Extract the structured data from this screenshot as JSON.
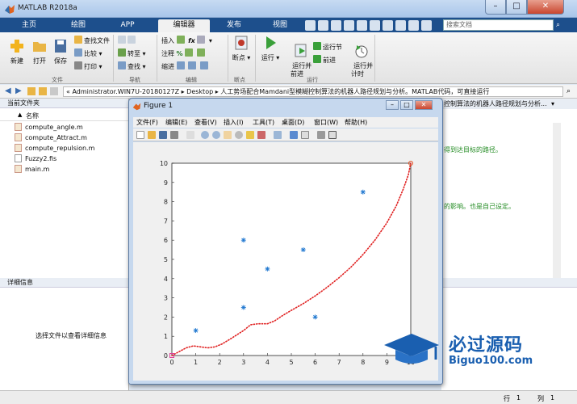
{
  "app": {
    "title": "MATLAB R2018a",
    "window_controls": {
      "min": "–",
      "max": "□",
      "close": "✕"
    }
  },
  "tabs": [
    "主页",
    "绘图",
    "APP",
    "编辑器",
    "发布",
    "视图"
  ],
  "active_tab": "编辑器",
  "search": {
    "placeholder": "搜索文档"
  },
  "ribbon": {
    "file": {
      "new": "新建",
      "open": "打开",
      "save": "保存",
      "find_file": "查找文件",
      "compare": "比较",
      "print": "打印",
      "section": "文件"
    },
    "nav": {
      "goto": "转至",
      "find": "查找",
      "section": "导航"
    },
    "edit": {
      "insert": "插入",
      "comment": "注释",
      "indent": "缩进",
      "section": "编辑"
    },
    "breakpoint": {
      "label": "断点",
      "section": "断点"
    },
    "run": {
      "run": "运行",
      "run_advance": "运行并\n前进",
      "run_section": "运行节",
      "advance": "前进",
      "run_time": "运行并\n计时",
      "section": "运行"
    }
  },
  "address": {
    "path": "« Administrator.WIN7U-20180127Z ▸ Desktop ▸ 人工势场配合Mamdani型模糊控制算法的机器人路径规划与分析。MATLAB代码，可直接运行"
  },
  "left_pane": {
    "title": "当前文件夹",
    "column": "名称",
    "files": [
      "compute_angle.m",
      "compute_Attract.m",
      "compute_repulsion.m",
      "Fuzzy2.fis",
      "main.m"
    ],
    "details_title": "详细信息",
    "details_hint": "选择文件以查看详细信息"
  },
  "editor": {
    "tab": "控制算法的机器人路径规划与分析...",
    "lines": [
      "得到达目标的路径。",
      "的影响。也是自己设定。"
    ]
  },
  "status": {
    "row_label": "行",
    "row": "1",
    "col_label": "列",
    "col": "1"
  },
  "figure": {
    "title": "Figure 1",
    "menu": [
      "文件(F)",
      "编辑(E)",
      "查看(V)",
      "插入(I)",
      "工具(T)",
      "桌面(D)",
      "窗口(W)",
      "帮助(H)"
    ]
  },
  "watermark": {
    "title": "必过源码",
    "url": "Biguo100.com"
  },
  "chart_data": {
    "type": "scatter",
    "xlim": [
      0,
      10
    ],
    "ylim": [
      0,
      10
    ],
    "xticks": [
      0,
      1,
      2,
      3,
      4,
      5,
      6,
      7,
      8,
      9,
      10
    ],
    "yticks": [
      0,
      1,
      2,
      3,
      4,
      5,
      6,
      7,
      8,
      9,
      10
    ],
    "grid": false,
    "obstacles": {
      "marker": "*",
      "color": "#1f77d0",
      "points": [
        [
          1,
          1.3
        ],
        [
          3,
          6
        ],
        [
          3,
          2.5
        ],
        [
          4,
          4.5
        ],
        [
          5.5,
          5.5
        ],
        [
          6,
          2
        ],
        [
          8,
          8.5
        ]
      ]
    },
    "start": {
      "marker": "square",
      "color": "#e0409a",
      "point": [
        0,
        0
      ]
    },
    "goal": {
      "marker": "circle",
      "color": "#e05020",
      "point": [
        10,
        10
      ]
    },
    "path": {
      "style": "dotted",
      "color": "#e02020",
      "points": [
        [
          0,
          0
        ],
        [
          0.3,
          0.2
        ],
        [
          0.6,
          0.4
        ],
        [
          0.9,
          0.5
        ],
        [
          1.2,
          0.45
        ],
        [
          1.5,
          0.4
        ],
        [
          1.8,
          0.45
        ],
        [
          2.1,
          0.6
        ],
        [
          2.5,
          0.9
        ],
        [
          3.0,
          1.3
        ],
        [
          3.3,
          1.6
        ],
        [
          3.6,
          1.65
        ],
        [
          4.0,
          1.65
        ],
        [
          4.3,
          1.8
        ],
        [
          4.6,
          2.05
        ],
        [
          5.0,
          2.35
        ],
        [
          5.5,
          2.7
        ],
        [
          6.0,
          3.1
        ],
        [
          6.5,
          3.55
        ],
        [
          7.0,
          4.05
        ],
        [
          7.5,
          4.6
        ],
        [
          8.0,
          5.25
        ],
        [
          8.5,
          6.0
        ],
        [
          9.0,
          6.9
        ],
        [
          9.4,
          7.8
        ],
        [
          9.7,
          8.7
        ],
        [
          9.9,
          9.4
        ],
        [
          10,
          10
        ]
      ]
    }
  }
}
